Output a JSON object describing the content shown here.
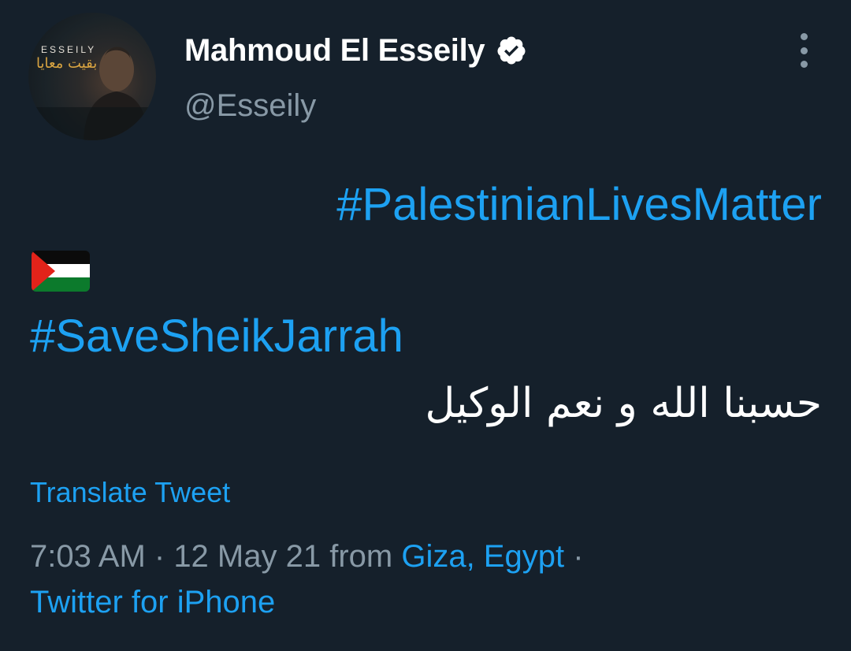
{
  "author": {
    "display_name": "Mahmoud El Esseily",
    "handle": "@Esseily",
    "verified": true,
    "avatar": {
      "brand_text": "ESSEILY",
      "script_text": "بقيت معايا"
    }
  },
  "menu": {
    "icon": "more-vertical-icon"
  },
  "tweet": {
    "hashtag_1": "#PalestinianLivesMatter",
    "flag_emoji": "palestine-flag-icon",
    "hashtag_2": "#SaveSheikJarrah",
    "arabic_text": "حسبنا الله و نعم الوكيل"
  },
  "translate_label": "Translate Tweet",
  "meta": {
    "time": "7:03 AM",
    "separator": " · ",
    "date": "12 May 21",
    "from_label": " from ",
    "location": "Giza, Egypt",
    "trailing_separator": " ·",
    "client": "Twitter for iPhone"
  },
  "colors": {
    "background": "#15202b",
    "link": "#1da1f2",
    "secondary_text": "#8899a6",
    "primary_text": "#ffffff"
  }
}
